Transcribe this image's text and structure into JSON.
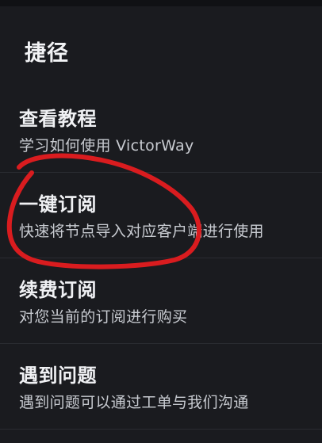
{
  "shortcuts": {
    "title": "捷径",
    "items": [
      {
        "title": "查看教程",
        "desc": "学习如何使用 VictorWay"
      },
      {
        "title": "一键订阅",
        "desc": "快速将节点导入对应客户端进行使用"
      },
      {
        "title": "续费订阅",
        "desc": "对您当前的订阅进行购买"
      },
      {
        "title": "遇到问题",
        "desc": "遇到问题可以通过工单与我们沟通"
      }
    ]
  },
  "annotation": {
    "color": "#d91c1f"
  }
}
